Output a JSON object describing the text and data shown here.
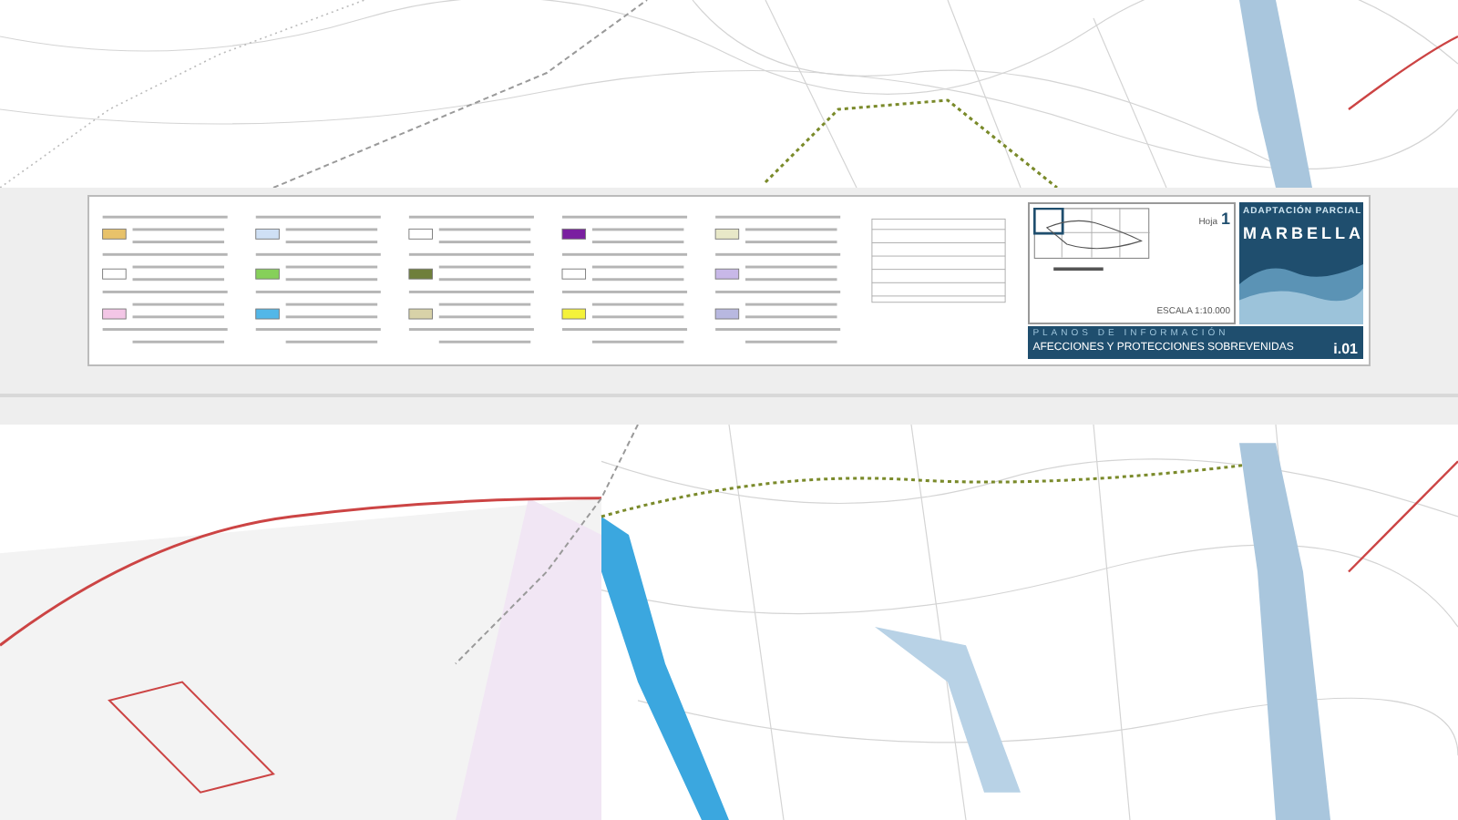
{
  "title_block": {
    "sheet_label": "Hoja",
    "sheet_number": "1",
    "scale": "ESCALA 1:10.000",
    "project_title": "ADAPTACIÓN PARCIAL",
    "city": "MARBELLA",
    "series": "PLANOS DE INFORMACIÓN",
    "plan_title": "AFECCIONES Y PROTECCIONES SOBREVENIDAS",
    "plan_code": "i.01"
  }
}
